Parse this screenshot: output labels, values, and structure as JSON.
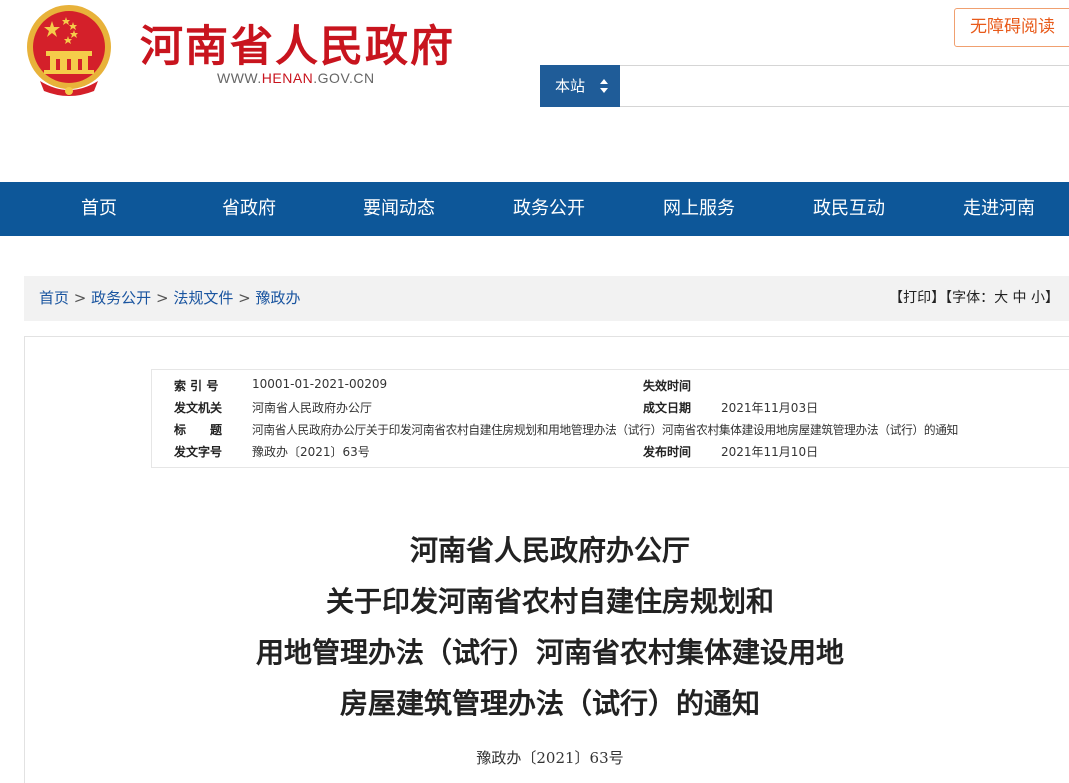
{
  "header": {
    "site_title": "河南省人民政府",
    "site_url_prefix": "WWW.",
    "site_url_brand": "HENAN",
    "site_url_suffix": ".GOV.CN",
    "accessibility_label": "无障碍阅读",
    "search": {
      "scope_label": "本站",
      "placeholder": ""
    },
    "colors": {
      "brand_red": "#c8141e",
      "nav_blue": "#0d5799"
    }
  },
  "nav": {
    "items": [
      {
        "label": "首页"
      },
      {
        "label": "省政府"
      },
      {
        "label": "要闻动态"
      },
      {
        "label": "政务公开"
      },
      {
        "label": "网上服务"
      },
      {
        "label": "政民互动"
      },
      {
        "label": "走进河南"
      }
    ]
  },
  "breadcrumb": {
    "items": [
      {
        "label": "首页"
      },
      {
        "label": "政务公开"
      },
      {
        "label": "法规文件"
      },
      {
        "label": "豫政办"
      }
    ],
    "separator": ">",
    "tools": {
      "print": "【打印】",
      "font_prefix": "【字体：",
      "font_large": "大",
      "font_medium": "中",
      "font_small": "小",
      "font_suffix": "】"
    }
  },
  "meta": {
    "index_label": "索 引 号",
    "index_value": "10001-01-2021-00209",
    "expire_label": "失效时间",
    "expire_value": "",
    "issuer_label": "发文机关",
    "issuer_value": "河南省人民政府办公厅",
    "created_label": "成文日期",
    "created_value": "2021年11月03日",
    "title_label": "标　　题",
    "title_value": "河南省人民政府办公厅关于印发河南省农村自建住房规划和用地管理办法（试行）河南省农村集体建设用地房屋建筑管理办法（试行）的通知",
    "docno_label": "发文字号",
    "docno_value": "豫政办〔2021〕63号",
    "published_label": "发布时间",
    "published_value": "2021年11月10日"
  },
  "document": {
    "title_lines": [
      "河南省人民政府办公厅",
      "关于印发河南省农村自建住房规划和",
      "用地管理办法（试行）河南省农村集体建设用地",
      "房屋建筑管理办法（试行）的通知"
    ],
    "doc_number": "豫政办〔2021〕63号"
  }
}
